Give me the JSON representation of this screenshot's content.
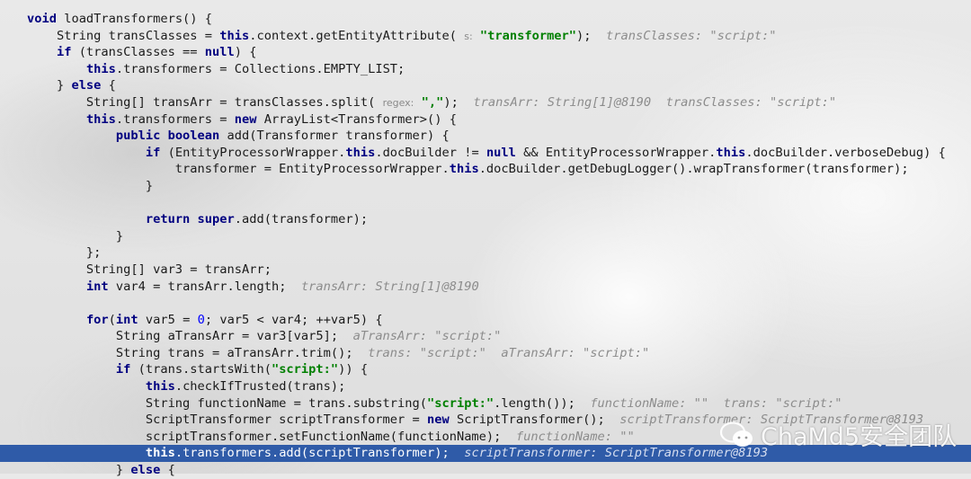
{
  "editor": {
    "highlight_color": "#2f5ba8",
    "highlighted_line": 26,
    "lines": [
      [
        [
          "kw",
          "void"
        ],
        [
          "p",
          " loadTransformers() {"
        ]
      ],
      [
        [
          "p",
          "    String transClasses = "
        ],
        [
          "kw",
          "this"
        ],
        [
          "p",
          ".context.getEntityAttribute( "
        ],
        [
          "hint",
          "s:"
        ],
        [
          "p",
          " "
        ],
        [
          "str",
          "\"transformer\""
        ],
        [
          "p",
          ");  "
        ],
        [
          "dbg",
          "transClasses: \"script:\""
        ]
      ],
      [
        [
          "p",
          "    "
        ],
        [
          "kw",
          "if"
        ],
        [
          "p",
          " (transClasses == "
        ],
        [
          "kw",
          "null"
        ],
        [
          "p",
          ") {"
        ]
      ],
      [
        [
          "p",
          "        "
        ],
        [
          "kw",
          "this"
        ],
        [
          "p",
          ".transformers = Collections.EMPTY_LIST;"
        ]
      ],
      [
        [
          "p",
          "    } "
        ],
        [
          "kw",
          "else"
        ],
        [
          "p",
          " {"
        ]
      ],
      [
        [
          "p",
          "        String[] transArr = transClasses.split( "
        ],
        [
          "hint",
          "regex:"
        ],
        [
          "p",
          " "
        ],
        [
          "str",
          "\",\""
        ],
        [
          "p",
          ");  "
        ],
        [
          "dbg",
          "transArr: String[1]@8190  transClasses: \"script:\""
        ]
      ],
      [
        [
          "p",
          "        "
        ],
        [
          "kw",
          "this"
        ],
        [
          "p",
          ".transformers = "
        ],
        [
          "kw",
          "new"
        ],
        [
          "p",
          " ArrayList<Transformer>() {"
        ]
      ],
      [
        [
          "p",
          "            "
        ],
        [
          "kw",
          "public boolean"
        ],
        [
          "p",
          " add(Transformer transformer) {"
        ]
      ],
      [
        [
          "p",
          "                "
        ],
        [
          "kw",
          "if"
        ],
        [
          "p",
          " (EntityProcessorWrapper."
        ],
        [
          "kw",
          "this"
        ],
        [
          "p",
          ".docBuilder != "
        ],
        [
          "kw",
          "null"
        ],
        [
          "p",
          " && EntityProcessorWrapper."
        ],
        [
          "kw",
          "this"
        ],
        [
          "p",
          ".docBuilder.verboseDebug) {"
        ]
      ],
      [
        [
          "p",
          "                    transformer = EntityProcessorWrapper."
        ],
        [
          "kw",
          "this"
        ],
        [
          "p",
          ".docBuilder.getDebugLogger().wrapTransformer(transformer);"
        ]
      ],
      [
        [
          "p",
          "                }"
        ]
      ],
      [],
      [
        [
          "p",
          "                "
        ],
        [
          "kw",
          "return super"
        ],
        [
          "p",
          ".add(transformer);"
        ]
      ],
      [
        [
          "p",
          "            }"
        ]
      ],
      [
        [
          "p",
          "        };"
        ]
      ],
      [
        [
          "p",
          "        String[] var3 = transArr;"
        ]
      ],
      [
        [
          "p",
          "        "
        ],
        [
          "kw",
          "int"
        ],
        [
          "p",
          " var4 = transArr.length;  "
        ],
        [
          "dbg",
          "transArr: String[1]@8190"
        ]
      ],
      [],
      [
        [
          "p",
          "        "
        ],
        [
          "kw",
          "for"
        ],
        [
          "p",
          "("
        ],
        [
          "kw",
          "int"
        ],
        [
          "p",
          " var5 = "
        ],
        [
          "num",
          "0"
        ],
        [
          "p",
          "; var5 < var4; ++var5) {"
        ]
      ],
      [
        [
          "p",
          "            String aTransArr = var3[var5];  "
        ],
        [
          "dbg",
          "aTransArr: \"script:\""
        ]
      ],
      [
        [
          "p",
          "            String trans = aTransArr.trim();  "
        ],
        [
          "dbg",
          "trans: \"script:\"  aTransArr: \"script:\""
        ]
      ],
      [
        [
          "p",
          "            "
        ],
        [
          "kw",
          "if"
        ],
        [
          "p",
          " (trans.startsWith("
        ],
        [
          "str",
          "\"script:\""
        ],
        [
          "p",
          ")) {"
        ]
      ],
      [
        [
          "p",
          "                "
        ],
        [
          "kw",
          "this"
        ],
        [
          "p",
          ".checkIfTrusted(trans);"
        ]
      ],
      [
        [
          "p",
          "                String functionName = trans.substring("
        ],
        [
          "str",
          "\"script:\""
        ],
        [
          "p",
          ".length());  "
        ],
        [
          "dbg",
          "functionName: \"\"  trans: \"script:\""
        ]
      ],
      [
        [
          "p",
          "                ScriptTransformer scriptTransformer = "
        ],
        [
          "kw",
          "new"
        ],
        [
          "p",
          " ScriptTransformer();  "
        ],
        [
          "dbg",
          "scriptTransformer: ScriptTransformer@8193"
        ]
      ],
      [
        [
          "p",
          "                scriptTransformer.setFunctionName(functionName);  "
        ],
        [
          "dbg",
          "functionName: \"\""
        ]
      ],
      [
        [
          "p",
          "                "
        ],
        [
          "kw",
          "this"
        ],
        [
          "p",
          ".transformers.add(scriptTransformer);  "
        ],
        [
          "dbg",
          "scriptTransformer: ScriptTransformer@8193"
        ]
      ],
      [
        [
          "p",
          "            } "
        ],
        [
          "kw",
          "else"
        ],
        [
          "p",
          " {"
        ]
      ]
    ]
  },
  "watermark": {
    "icon": "wechat-icon",
    "text": "ChaMd5安全团队"
  }
}
